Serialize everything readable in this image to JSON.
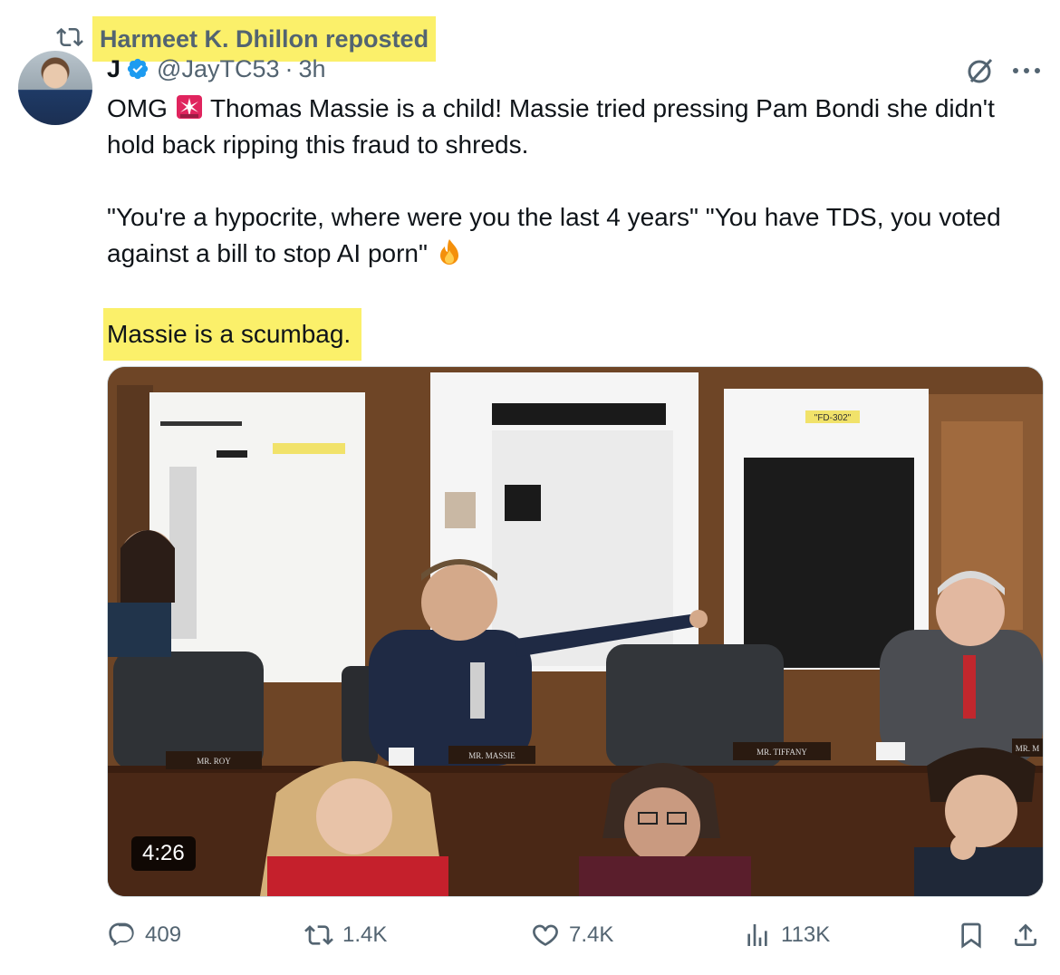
{
  "repost": {
    "label": "Harmeet K. Dhillon reposted",
    "icon": "repost-icon"
  },
  "author": {
    "display_name": "J",
    "handle": "@JayTC53",
    "time": "3h",
    "verified": true
  },
  "tweet": {
    "para1_a": "OMG",
    "para1_b": "Thomas Massie is a child! Massie tried pressing Pam Bondi she didn't hold back ripping this fraud to shreds.",
    "para2_a": "\"You're a hypocrite, where were you the last 4 years\"  \"You have TDS, you voted against a bill to stop AI porn\"",
    "para3": "Massie is a scumbag."
  },
  "media": {
    "duration": "4:26",
    "board_callout_1": "\"FD-302\"",
    "nameplates": [
      "MR. ROY",
      "MR. MASSIE",
      "MR. TIFFANY",
      "MR. M"
    ]
  },
  "actions": {
    "replies": "409",
    "reposts": "1.4K",
    "likes": "7.4K",
    "views": "113K"
  },
  "colors": {
    "highlight": "#fbf06a",
    "verified": "#1d9bf0",
    "muted": "#536471"
  }
}
